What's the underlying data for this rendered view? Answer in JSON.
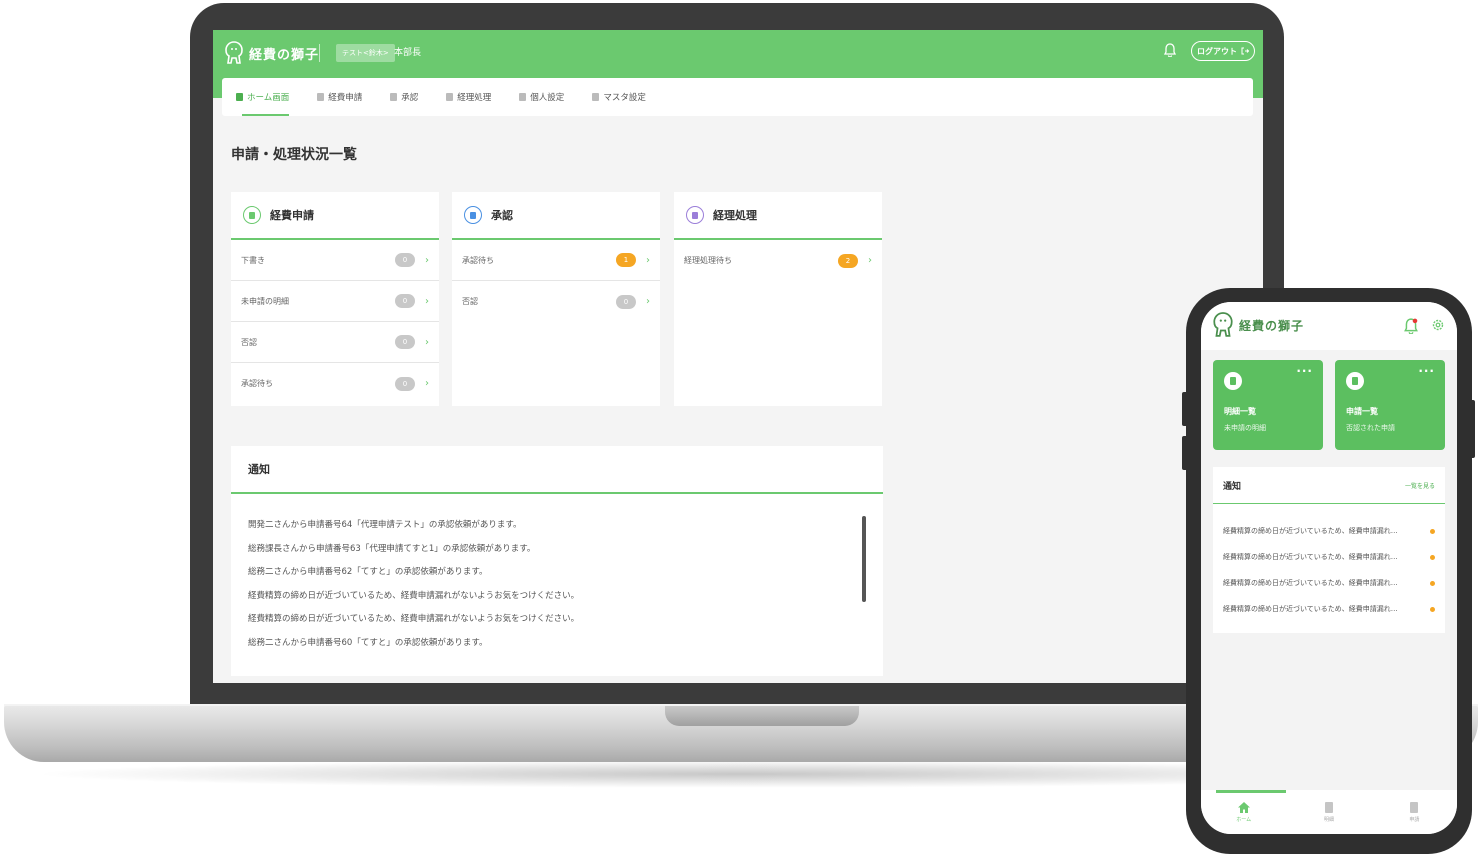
{
  "app": {
    "name": "経費の獅子"
  },
  "header": {
    "user_badge": "テスト<鈴木>",
    "user_role": "本部長",
    "logout_label": "ログアウト"
  },
  "nav": {
    "items": [
      {
        "label": "ホーム画面",
        "active": true
      },
      {
        "label": "経費申請"
      },
      {
        "label": "承認"
      },
      {
        "label": "経理処理"
      },
      {
        "label": "個人設定"
      },
      {
        "label": "マスタ設定"
      }
    ]
  },
  "page": {
    "title": "申請・処理状況一覧"
  },
  "cards": [
    {
      "title": "経費申請",
      "color": "#6bc96f",
      "rows": [
        {
          "label": "下書き",
          "count": "0"
        },
        {
          "label": "未申請の明細",
          "count": "0"
        },
        {
          "label": "否認",
          "count": "0"
        },
        {
          "label": "承認待ち",
          "count": "0"
        }
      ]
    },
    {
      "title": "承認",
      "color": "#4a90e2",
      "rows": [
        {
          "label": "承認待ち",
          "count": "1"
        },
        {
          "label": "否認",
          "count": "0"
        }
      ]
    },
    {
      "title": "経理処理",
      "color": "#9b7ed9",
      "rows": [
        {
          "label": "経理処理待ち",
          "count": "2"
        }
      ]
    }
  ],
  "notice": {
    "title": "通知",
    "items": [
      "開発二さんから申請番号64「代理申請テスト」の承認依頼があります。",
      "総務課長さんから申請番号63「代理申請てすと1」の承認依頼があります。",
      "総務二さんから申請番号62「てすと」の承認依頼があります。",
      "経費精算の締め日が近づいているため、経費申請漏れがないようお気をつけください。",
      "経費精算の締め日が近づいているため、経費申請漏れがないようお気をつけください。",
      "総務二さんから申請番号60「てすと」の承認依頼があります。"
    ]
  },
  "mobile": {
    "tiles": [
      {
        "title": "明細一覧",
        "sub": "未申請の明細"
      },
      {
        "title": "申請一覧",
        "sub": "否認された申請"
      }
    ],
    "notice": {
      "title": "通知",
      "more": "一覧を見る",
      "items": [
        "経費精算の締め日が近づいているため、経費申請漏れ…",
        "経費精算の締め日が近づいているため、経費申請漏れ…",
        "経費精算の締め日が近づいているため、経費申請漏れ…",
        "経費精算の締め日が近づいているため、経費申請漏れ…"
      ]
    },
    "tabs": [
      {
        "label": "ホーム",
        "active": true
      },
      {
        "label": "明細"
      },
      {
        "label": "申請"
      }
    ]
  },
  "colors": {
    "brand": "#6bc96f",
    "badge_orange": "#f5a623",
    "badge_gray": "#c8c8c8"
  }
}
